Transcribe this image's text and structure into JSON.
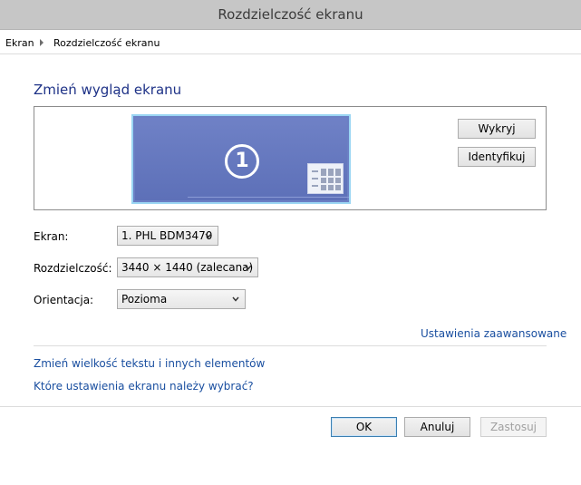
{
  "window": {
    "title": "Rozdzielczość ekranu"
  },
  "breadcrumb": {
    "items": [
      "Ekran",
      "Rozdzielczość ekranu"
    ]
  },
  "main": {
    "heading": "Zmień wygląd ekranu",
    "monitor": {
      "number": "1"
    },
    "buttons": {
      "detect": "Wykryj",
      "identify": "Identyfikuj"
    },
    "fields": {
      "display": {
        "label": "Ekran:",
        "value": "1. PHL BDM3470"
      },
      "resolution": {
        "label": "Rozdzielczość:",
        "value": "3440 × 1440 (zalecana)"
      },
      "orientation": {
        "label": "Orientacja:",
        "value": "Pozioma"
      }
    },
    "advanced_link": "Ustawienia zaawansowane",
    "links": {
      "text_size": "Zmień wielkość tekstu i innych elementów",
      "which_settings": "Które ustawienia ekranu należy wybrać?"
    }
  },
  "footer": {
    "ok": "OK",
    "cancel": "Anuluj",
    "apply": "Zastosuj"
  },
  "colors": {
    "heading": "#1e3287",
    "link": "#1a4fa0",
    "monitor": "#6b7fc4",
    "titlebar": "#c6c6c6"
  }
}
